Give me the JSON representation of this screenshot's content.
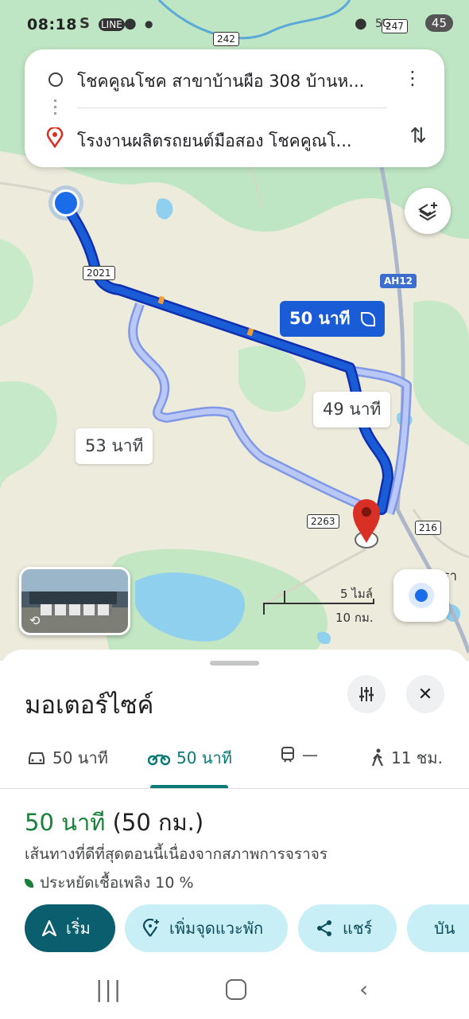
{
  "status_bar": {
    "time": "08:18",
    "battery": "45"
  },
  "search": {
    "origin": "โชคคูณโชค สาขาบ้านผือ 308 บ้านห...",
    "destination": "โรงงานผลิตรถยนต์มือสอง โชคคูณโ..."
  },
  "map": {
    "route_main_label": "50 นาที",
    "route_alt1_label": "49 นาที",
    "route_alt2_label": "53 นาที",
    "road_2021": "2021",
    "road_242": "242",
    "road_247": "247",
    "road_ah12": "AH12",
    "road_2263": "2263",
    "road_216": "216",
    "place_partial": "ครา",
    "scale_miles": "5 ไมล์",
    "scale_km": "10 กม."
  },
  "sheet": {
    "mode_title": "มอเตอร์ไซค์",
    "tabs": [
      {
        "icon": "car-icon",
        "label": "50 นาที"
      },
      {
        "icon": "motorcycle-icon",
        "label": "50 นาที"
      },
      {
        "icon": "train-icon",
        "label": "—"
      },
      {
        "icon": "walk-icon",
        "label": "11 ชม."
      }
    ],
    "summary_duration": "50 นาที",
    "summary_distance": "(50 กม.)",
    "route_description": "เส้นทางที่ดีที่สุดตอนนี้เนื่องจากสภาพการจราจร",
    "eco_text": "ประหยัดเชื้อเพลิง 10 %",
    "actions": {
      "start": "เริ่ม",
      "add_stop": "เพิ่มจุดแวะพัก",
      "share": "แชร์",
      "save": "บัน"
    }
  },
  "colors": {
    "route_main": "#1a5bd6",
    "route_alt": "#a8b9f0",
    "accent_teal": "#0b7a75",
    "duration_green": "#188038",
    "destination_red": "#d93025"
  }
}
